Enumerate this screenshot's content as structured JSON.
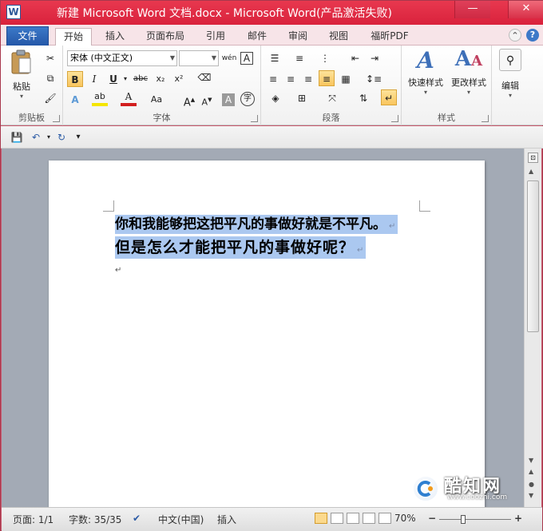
{
  "window": {
    "title": "新建 Microsoft Word 文档.docx - Microsoft Word(产品激活失败)",
    "app_icon": "W",
    "minimize": "—",
    "close": "✕"
  },
  "menu": {
    "tabs": [
      "文件",
      "开始",
      "插入",
      "页面布局",
      "引用",
      "邮件",
      "审阅",
      "视图",
      "福昕PDF"
    ],
    "active": "开始"
  },
  "ribbon": {
    "clipboard": {
      "label": "剪贴板",
      "paste": "粘贴"
    },
    "font": {
      "label": "字体",
      "font_name": "宋体 (中文正文)",
      "font_size": "",
      "bold": "B",
      "italic": "I",
      "underline": "U",
      "strike": "abc",
      "subscript": "x₂",
      "superscript": "x²",
      "grow": "A",
      "shrink": "A",
      "case": "Aa",
      "clear": "A",
      "phonetic": "wén",
      "border_char": "A",
      "char_shading": "A",
      "enclose": "字"
    },
    "paragraph": {
      "label": "段落"
    },
    "styles": {
      "label": "样式",
      "quick_styles": "快速样式",
      "change_styles": "更改样式"
    },
    "editing": {
      "label": "编辑"
    }
  },
  "document": {
    "line1": "你和我能够把这把平凡的事做好就是不平凡。",
    "line2": "但是怎么才能把平凡的事做好呢？",
    "para_mark": "↵"
  },
  "status": {
    "page": "页面: 1/1",
    "words": "字数: 35/35",
    "language": "中文(中国)",
    "insert_mode": "插入",
    "zoom": "70%",
    "zoom_minus": "−",
    "zoom_plus": "+",
    "zoom_level": 0.7
  },
  "watermark": {
    "brand": "酷知网",
    "url": "www.coozhi.com"
  },
  "colors": {
    "titlebar": "#d9223c",
    "file_tab": "#2457a8",
    "selection": "#abc8f0",
    "highlight_button": "#f9c55e"
  }
}
